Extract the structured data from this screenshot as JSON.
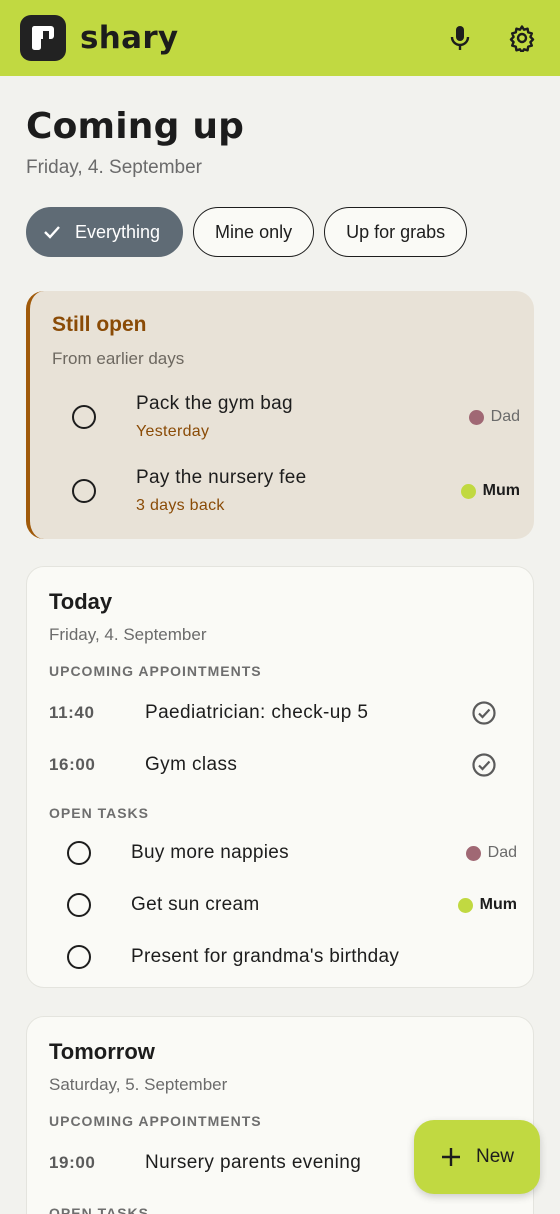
{
  "app": {
    "title": "shary"
  },
  "colors": {
    "accent": "#c1d941",
    "warning": "#8a4b06",
    "dad": "#a06874",
    "mum": "#c1d941",
    "chip_active": "#5f6b75"
  },
  "header": {
    "title": "Coming up",
    "date": "Friday, 4. September"
  },
  "icons": {
    "mic": "microphone-icon",
    "settings": "gear-icon",
    "check": "check-icon",
    "add": "plus-icon",
    "done": "check-circle-icon"
  },
  "filters": [
    {
      "label": "Everything",
      "selected": true
    },
    {
      "label": "Mine only",
      "selected": false
    },
    {
      "label": "Up for grabs",
      "selected": false
    }
  ],
  "still_open": {
    "title": "Still open",
    "subtitle": "From earlier days",
    "tasks": [
      {
        "title": "Pack the gym bag",
        "due": "Yesterday",
        "assignee": "Dad"
      },
      {
        "title": "Pay the nursery fee",
        "due": "3 days back",
        "assignee": "Mum"
      }
    ]
  },
  "today": {
    "title": "Today",
    "date": "Friday, 4. September",
    "appointments_label": "UPCOMING APPOINTMENTS",
    "appointments": [
      {
        "time": "11:40",
        "title": "Paediatrician: check-up 5"
      },
      {
        "time": "16:00",
        "title": "Gym class"
      }
    ],
    "tasks_label": "OPEN TASKS",
    "tasks": [
      {
        "title": "Buy more nappies",
        "assignee": "Dad"
      },
      {
        "title": "Get sun cream",
        "assignee": "Mum"
      },
      {
        "title": "Present for grandma's birthday",
        "assignee": ""
      }
    ]
  },
  "tomorrow": {
    "title": "Tomorrow",
    "date": "Saturday, 5. September",
    "appointments_label": "UPCOMING APPOINTMENTS",
    "appointments": [
      {
        "time": "19:00",
        "title": "Nursery parents evening"
      }
    ],
    "tasks_label": "OPEN TASKS"
  },
  "fab": {
    "label": "New"
  }
}
